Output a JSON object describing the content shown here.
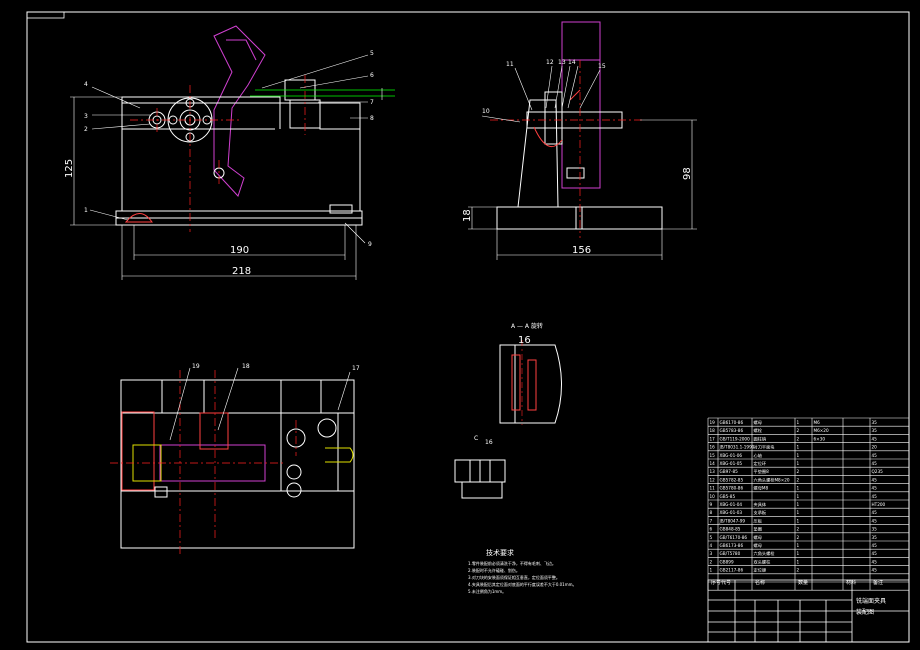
{
  "colors": {
    "background": "#000000",
    "line": "#ffffff",
    "center": "#ff2020",
    "part": "#d040d0",
    "leader": "#00ff00",
    "hatch": "#ff4040",
    "cyan": "#00e0e0",
    "yellow": "#e0e000"
  },
  "front_view": {
    "dims": {
      "height": "125",
      "inner_width": "190",
      "total_width": "218"
    },
    "balloons": [
      "1",
      "2",
      "3",
      "4",
      "5",
      "6",
      "7",
      "8",
      "9"
    ]
  },
  "side_view": {
    "dims": {
      "height": "98",
      "base": "18",
      "width": "156"
    },
    "balloons": [
      "10",
      "11",
      "12",
      "13",
      "14",
      "15"
    ]
  },
  "top_view": {
    "balloons": [
      "17",
      "18",
      "19"
    ]
  },
  "section": {
    "title": "A — A  旋转",
    "dim": "16"
  },
  "detail": {
    "label": "C",
    "balloon": "16"
  },
  "tech": {
    "title": "技术要求",
    "lines": [
      "1.零件装配前必须清洗干净，不得有毛刺、飞边。",
      "2.装配时不允许磕碰、划伤。",
      "3.对刀块的安装面须保证相互垂直，定位面须平整。",
      "4.夹具装配后其定位面对底面的平行度误差不大于0.01mm。",
      "5.未注倒角为1mm。"
    ]
  },
  "bom": {
    "rows": [
      [
        "19",
        "GB6170-86",
        "螺母",
        "1",
        "M6",
        "",
        "35"
      ],
      [
        "18",
        "GB5783-86",
        "螺栓",
        "2",
        "M6×20",
        "",
        "35"
      ],
      [
        "17",
        "GB/T119-2000",
        "圆柱销",
        "2",
        "6×30",
        "",
        "45"
      ],
      [
        "16",
        "JB/T8031.1-1999",
        "对刀平面块",
        "1",
        "",
        "",
        "20"
      ],
      [
        "15",
        "XBG-01-06",
        "心轴",
        "1",
        "",
        "",
        "45"
      ],
      [
        "14",
        "XBG-01-05",
        "定位环",
        "1",
        "",
        "",
        "45"
      ],
      [
        "13",
        "GB97-85",
        "平垫圈8",
        "2",
        "",
        "",
        "Q235"
      ],
      [
        "12",
        "GB5782-85",
        "六角头螺栓M8×20",
        "2",
        "",
        "",
        "45"
      ],
      [
        "11",
        "GB5780-86",
        "螺母M8",
        "1",
        "",
        "",
        "45"
      ],
      [
        "10",
        "GB5-85",
        "",
        "1",
        "",
        "",
        "45"
      ],
      [
        "9",
        "XBG-01-04",
        "夹具体",
        "1",
        "",
        "",
        "HT200"
      ],
      [
        "8",
        "XBG-01-03",
        "支承板",
        "1",
        "",
        "",
        "45"
      ],
      [
        "7",
        "JB/T8047-99",
        "压板",
        "1",
        "",
        "",
        "45"
      ],
      [
        "6",
        "GB848-85",
        "垫圈",
        "2",
        "",
        "",
        "35"
      ],
      [
        "5",
        "GB/T6170-86",
        "螺母",
        "2",
        "",
        "",
        "35"
      ],
      [
        "4",
        "GB6173-86",
        "螺母",
        "1",
        "",
        "",
        "45"
      ],
      [
        "3",
        "GB/T5780",
        "六角头螺栓",
        "1",
        "",
        "",
        "45"
      ],
      [
        "2",
        "GB899",
        "双头螺柱",
        "1",
        "",
        "",
        "45"
      ],
      [
        "1",
        "GB2117-86",
        "定位键",
        "2",
        "",
        "",
        "45"
      ]
    ],
    "header": [
      "序号",
      "代号",
      "名称",
      "数量",
      "材料",
      "备注"
    ]
  },
  "title_block": {
    "name": "铣端面夹具",
    "subtitle": "装配图"
  }
}
